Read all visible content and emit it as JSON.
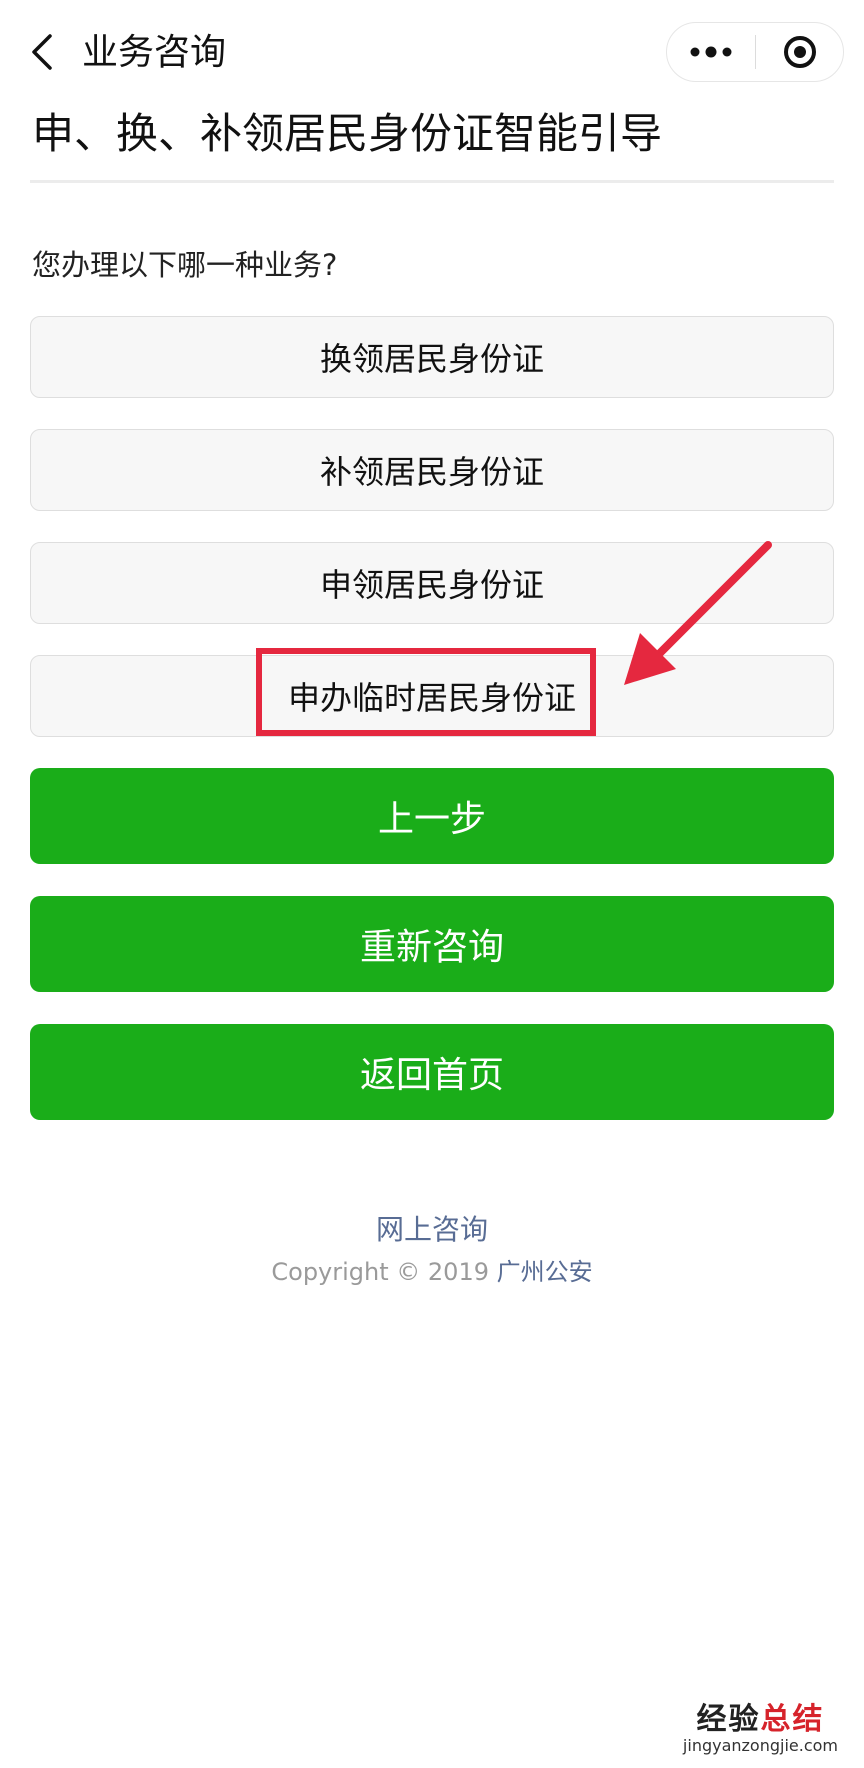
{
  "nav": {
    "title": "业务咨询"
  },
  "page": {
    "title": "申、换、补领居民身份证智能引导",
    "question": "您办理以下哪一种业务?"
  },
  "options": [
    {
      "label": "换领居民身份证"
    },
    {
      "label": "补领居民身份证"
    },
    {
      "label": "申领居民身份证"
    },
    {
      "label": "申办临时居民身份证"
    }
  ],
  "actions": {
    "prev": "上一步",
    "restart": "重新咨询",
    "home": "返回首页"
  },
  "footer": {
    "link": "网上咨询",
    "copyright_prefix": "Copyright © 2019",
    "org": "广州公安"
  },
  "watermark": {
    "main_a": "经验",
    "main_b": "总结",
    "sub": "jingyanzongjie.com"
  },
  "colors": {
    "primary_button": "#1aad19",
    "highlight": "#e5283f",
    "link": "#586c94"
  }
}
